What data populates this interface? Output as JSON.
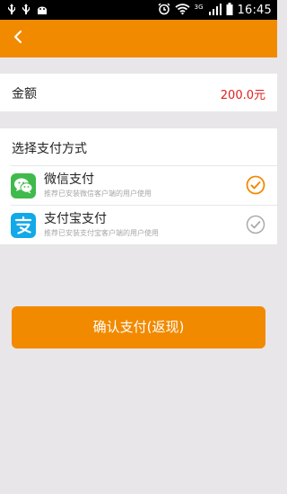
{
  "status_bar": {
    "time": "16:45",
    "network": "3G"
  },
  "amount": {
    "label": "金额",
    "value": "200.0元"
  },
  "payment": {
    "title": "选择支付方式",
    "options": [
      {
        "name": "微信支付",
        "description": "推荐已安装微信客户端的用户使用",
        "selected": true
      },
      {
        "name": "支付宝支付",
        "description": "推荐已安装支付宝客户端的用户使用",
        "selected": false
      }
    ]
  },
  "confirm": {
    "label": "确认支付(返现)"
  },
  "colors": {
    "accent": "#f28a00",
    "amount": "#e02020",
    "wechat": "#3fba4b",
    "alipay": "#12a9e8"
  }
}
